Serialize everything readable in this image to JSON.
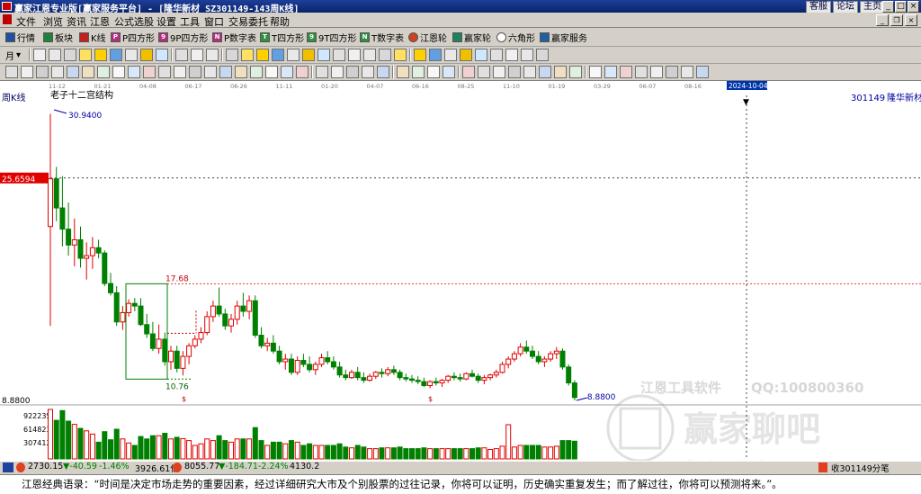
{
  "window": {
    "title": "赢家江恩专业版[赢家服务平台] - [隆华新材  SZ301149-143周K线]",
    "links": [
      "客服",
      "论坛",
      "主页"
    ],
    "controls": [
      "_",
      "□",
      "×"
    ]
  },
  "menu": [
    "文件",
    "浏览",
    "资讯",
    "江恩",
    "公式选股",
    "设置",
    "工具",
    "窗口",
    "交易委托",
    "帮助"
  ],
  "toolbar": [
    {
      "label": "行情",
      "icon": "quote-table-icon"
    },
    {
      "label": "板块",
      "icon": "sector-icon"
    },
    {
      "label": "K线",
      "icon": "kline-icon"
    },
    {
      "label": "P四方形",
      "icon": "P"
    },
    {
      "label": "9P四方形",
      "icon": "9P"
    },
    {
      "label": "P数字表",
      "icon": "PN"
    },
    {
      "label": "T四方形",
      "icon": "T"
    },
    {
      "label": "9T四方形",
      "icon": "9T"
    },
    {
      "label": "T数字表",
      "icon": "TN"
    },
    {
      "label": "江恩轮",
      "icon": "gann-wheel-icon"
    },
    {
      "label": "赢家轮",
      "icon": "winner-wheel-icon"
    },
    {
      "label": "六角形",
      "icon": "hexagon-icon"
    },
    {
      "label": "赢家服务",
      "icon": "service-icon"
    }
  ],
  "period_selector": "月",
  "date_axis": [
    "11-12",
    "01-21",
    "04-08",
    "06-17",
    "08-26",
    "11-11",
    "01-20",
    "04-07",
    "06-16",
    "08-25",
    "11-10",
    "01-19",
    "03-29",
    "06-07",
    "08-16"
  ],
  "cursor_date": "2024-10-04",
  "chart_header": {
    "period_label": "周K线",
    "stock_code": "301149",
    "stock_name": "隆华新材",
    "study_label": "老子十二宫结构"
  },
  "price_labels": {
    "high": "30.9400",
    "low": "8.8800",
    "box_top": "17.68",
    "box_bottom": "10.76",
    "cursor_price": "25.6594",
    "axis_min": "8.8800"
  },
  "volume_axis": [
    "922235",
    "614823",
    "307412"
  ],
  "watermark": {
    "company": "江恩工具软件",
    "qq": "QQ:100800360",
    "brand": "赢家聊吧",
    "url": "jiaoba.yingjia.com"
  },
  "status": {
    "sh": "2730.15",
    "sh_chg": "▼-40.59",
    "sh_pct": "-1.46%",
    "sh_amt": "3926.61亿",
    "sz": "8055.77",
    "sz_chg": "▼-184.71",
    "sz_pct": "-2.24%",
    "sz_amt": "4130.2",
    "right": "收301149分笔"
  },
  "quote": "江恩经典语录：“时间是决定市场走势的重要因素，经过详细研究大市及个别股票的过往记录，你将可以证明，历史确实重复发生；而了解过往，你将可以预测将来。”。",
  "chart_data": {
    "type": "candlestick",
    "price_range": [
      8.88,
      30.94
    ],
    "up_color": "#e00000",
    "down_color": "#008000",
    "candles": [
      [
        22,
        30.5,
        14.5,
        25.6
      ],
      [
        25.6,
        26.5,
        22.4,
        23.4
      ],
      [
        23.4,
        25.8,
        20.5,
        21.8
      ],
      [
        21.8,
        23.8,
        19.8,
        20.6
      ],
      [
        20.6,
        22.6,
        19.0,
        21.0
      ],
      [
        21.0,
        22.0,
        18.9,
        19.6
      ],
      [
        19.6,
        20.8,
        18.0,
        19.8
      ],
      [
        19.8,
        21.2,
        18.8,
        20.4
      ],
      [
        20.4,
        21.0,
        19.6,
        20.0
      ],
      [
        20.0,
        20.2,
        17.5,
        17.7
      ],
      [
        17.7,
        18.5,
        16.8,
        17.0
      ],
      [
        17.0,
        17.5,
        14.5,
        14.8
      ],
      [
        14.8,
        16.0,
        14.2,
        15.5
      ],
      [
        15.5,
        16.5,
        15.2,
        16.2
      ],
      [
        16.2,
        16.6,
        15.6,
        16.0
      ],
      [
        16.0,
        16.6,
        14.5,
        14.6
      ],
      [
        14.6,
        15.4,
        13.6,
        13.9
      ],
      [
        13.9,
        14.8,
        12.6,
        12.8
      ],
      [
        12.8,
        14.6,
        12.4,
        13.5
      ],
      [
        13.5,
        14.0,
        11.5,
        11.8
      ],
      [
        11.8,
        13.0,
        11.2,
        12.6
      ],
      [
        12.6,
        13.0,
        11.0,
        11.3
      ],
      [
        11.3,
        12.6,
        10.76,
        12.2
      ],
      [
        12.2,
        13.2,
        11.6,
        13.0
      ],
      [
        13.0,
        13.8,
        12.8,
        13.5
      ],
      [
        13.5,
        14.4,
        13.2,
        14.0
      ],
      [
        14.0,
        15.6,
        13.8,
        15.2
      ],
      [
        15.2,
        16.4,
        14.8,
        16.0
      ],
      [
        16.0,
        17.4,
        15.2,
        15.4
      ],
      [
        15.4,
        15.8,
        14.2,
        14.5
      ],
      [
        14.5,
        15.4,
        14.0,
        15.0
      ],
      [
        15.0,
        16.4,
        14.6,
        16.0
      ],
      [
        16.0,
        17.0,
        15.2,
        15.6
      ],
      [
        15.6,
        16.8,
        15.0,
        16.4
      ],
      [
        16.4,
        16.8,
        13.6,
        13.8
      ],
      [
        13.8,
        14.4,
        12.8,
        13.0
      ],
      [
        13.0,
        13.6,
        12.6,
        13.2
      ],
      [
        13.2,
        13.8,
        12.4,
        12.6
      ],
      [
        12.6,
        13.0,
        11.6,
        11.8
      ],
      [
        11.8,
        12.4,
        11.2,
        12.0
      ],
      [
        12.0,
        12.4,
        10.8,
        11.0
      ],
      [
        11.0,
        12.2,
        10.8,
        11.9
      ],
      [
        11.9,
        12.4,
        11.4,
        11.6
      ],
      [
        11.6,
        12.2,
        11.0,
        11.2
      ],
      [
        11.2,
        11.8,
        10.8,
        11.6
      ],
      [
        11.6,
        12.4,
        11.4,
        12.1
      ],
      [
        12.1,
        12.6,
        11.6,
        11.8
      ],
      [
        11.8,
        12.2,
        11.2,
        11.4
      ],
      [
        11.4,
        11.8,
        10.6,
        10.8
      ],
      [
        10.8,
        11.2,
        10.4,
        10.6
      ],
      [
        10.6,
        11.2,
        10.5,
        11.0
      ],
      [
        11.0,
        11.4,
        10.4,
        10.6
      ],
      [
        10.6,
        11.0,
        10.2,
        10.4
      ],
      [
        10.4,
        10.9,
        10.3,
        10.7
      ],
      [
        10.7,
        11.1,
        10.5,
        11.0
      ],
      [
        11.0,
        11.3,
        10.6,
        10.9
      ],
      [
        10.9,
        11.4,
        10.7,
        11.2
      ],
      [
        11.2,
        11.5,
        10.8,
        11.0
      ],
      [
        11.0,
        11.2,
        10.4,
        10.6
      ],
      [
        10.6,
        10.9,
        10.3,
        10.5
      ],
      [
        10.5,
        10.8,
        10.2,
        10.4
      ],
      [
        10.4,
        10.7,
        10.1,
        10.3
      ],
      [
        10.3,
        10.6,
        9.9,
        10.0
      ],
      [
        10.0,
        10.4,
        9.8,
        10.3
      ],
      [
        10.3,
        10.6,
        10.0,
        10.2
      ],
      [
        10.2,
        10.5,
        9.9,
        10.4
      ],
      [
        10.4,
        10.8,
        10.2,
        10.7
      ],
      [
        10.7,
        11.0,
        10.4,
        10.6
      ],
      [
        10.6,
        10.9,
        10.3,
        10.5
      ],
      [
        10.5,
        11.0,
        10.4,
        10.9
      ],
      [
        10.9,
        11.2,
        10.6,
        10.7
      ],
      [
        10.7,
        10.9,
        10.2,
        10.4
      ],
      [
        10.4,
        10.8,
        10.1,
        10.6
      ],
      [
        10.6,
        10.9,
        10.4,
        10.8
      ],
      [
        10.8,
        11.2,
        10.6,
        11.0
      ],
      [
        11.0,
        11.8,
        10.9,
        11.6
      ],
      [
        11.6,
        12.2,
        11.3,
        12.0
      ],
      [
        12.0,
        12.6,
        11.8,
        12.4
      ],
      [
        12.4,
        13.2,
        12.2,
        12.9
      ],
      [
        12.9,
        13.4,
        12.4,
        12.6
      ],
      [
        12.6,
        13.0,
        12.0,
        12.2
      ],
      [
        12.2,
        12.6,
        11.6,
        11.8
      ],
      [
        11.8,
        12.2,
        11.4,
        12.0
      ],
      [
        12.0,
        12.6,
        11.8,
        12.4
      ],
      [
        12.4,
        12.9,
        12.0,
        12.6
      ],
      [
        12.6,
        12.8,
        11.2,
        11.4
      ],
      [
        11.4,
        11.6,
        10.0,
        10.2
      ],
      [
        10.2,
        10.4,
        8.88,
        9.1
      ]
    ],
    "annotations": {
      "high": 30.94,
      "low": 8.88,
      "box_top": 17.68,
      "box_bottom": 10.76,
      "cursor_level": 25.6594
    },
    "volume_labels": [
      "922235",
      "614823",
      "307412"
    ]
  }
}
